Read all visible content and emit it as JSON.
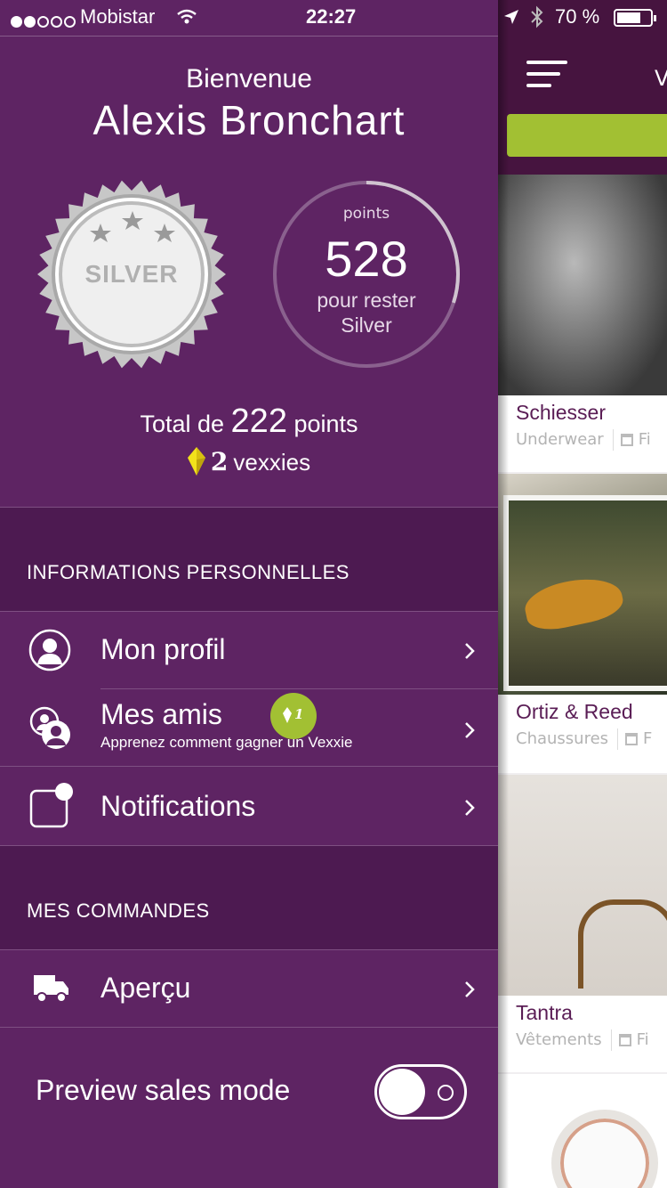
{
  "status_bar": {
    "carrier": "Mobistar",
    "time": "22:27",
    "battery": "70 %"
  },
  "profile": {
    "welcome": "Bienvenue",
    "name": "Alexis Bronchart",
    "badge_label": "SILVER",
    "points_caption": "points",
    "points_value": "528",
    "points_sub_line1": "pour rester",
    "points_sub_line2": "Silver",
    "points_progress": 0.3,
    "total_prefix": "Total de",
    "total_value": "222",
    "total_suffix": "points",
    "vexxie_count": "2",
    "vexxie_label": "vexxies"
  },
  "sections": {
    "personal_title": "INFORMATIONS PERSONNELLES",
    "orders_title": "MES COMMANDES"
  },
  "menu": {
    "profile": "Mon profil",
    "friends": "Mes amis",
    "friends_sub": "Apprenez comment gagner un Vexxie",
    "friends_badge": "1",
    "notifications": "Notifications",
    "overview": "Aperçu"
  },
  "preview": {
    "label": "Preview sales mode",
    "enabled": false
  },
  "right_panel": {
    "cards": [
      {
        "brand": "Schiesser",
        "category": "Underwear",
        "date_fragment": "Fi"
      },
      {
        "brand": "Ortiz & Reed",
        "category": "Chaussures",
        "date_fragment": "F"
      },
      {
        "brand": "Tantra",
        "category": "Vêtements",
        "date_fragment": "Fi"
      }
    ]
  },
  "colors": {
    "drawer_bg": "#5e2463",
    "section_bg": "#4d1a51",
    "accent_green": "#a2c033",
    "vexxie_yellow": "#f2e21b",
    "brand_purple": "#5a1d55"
  }
}
